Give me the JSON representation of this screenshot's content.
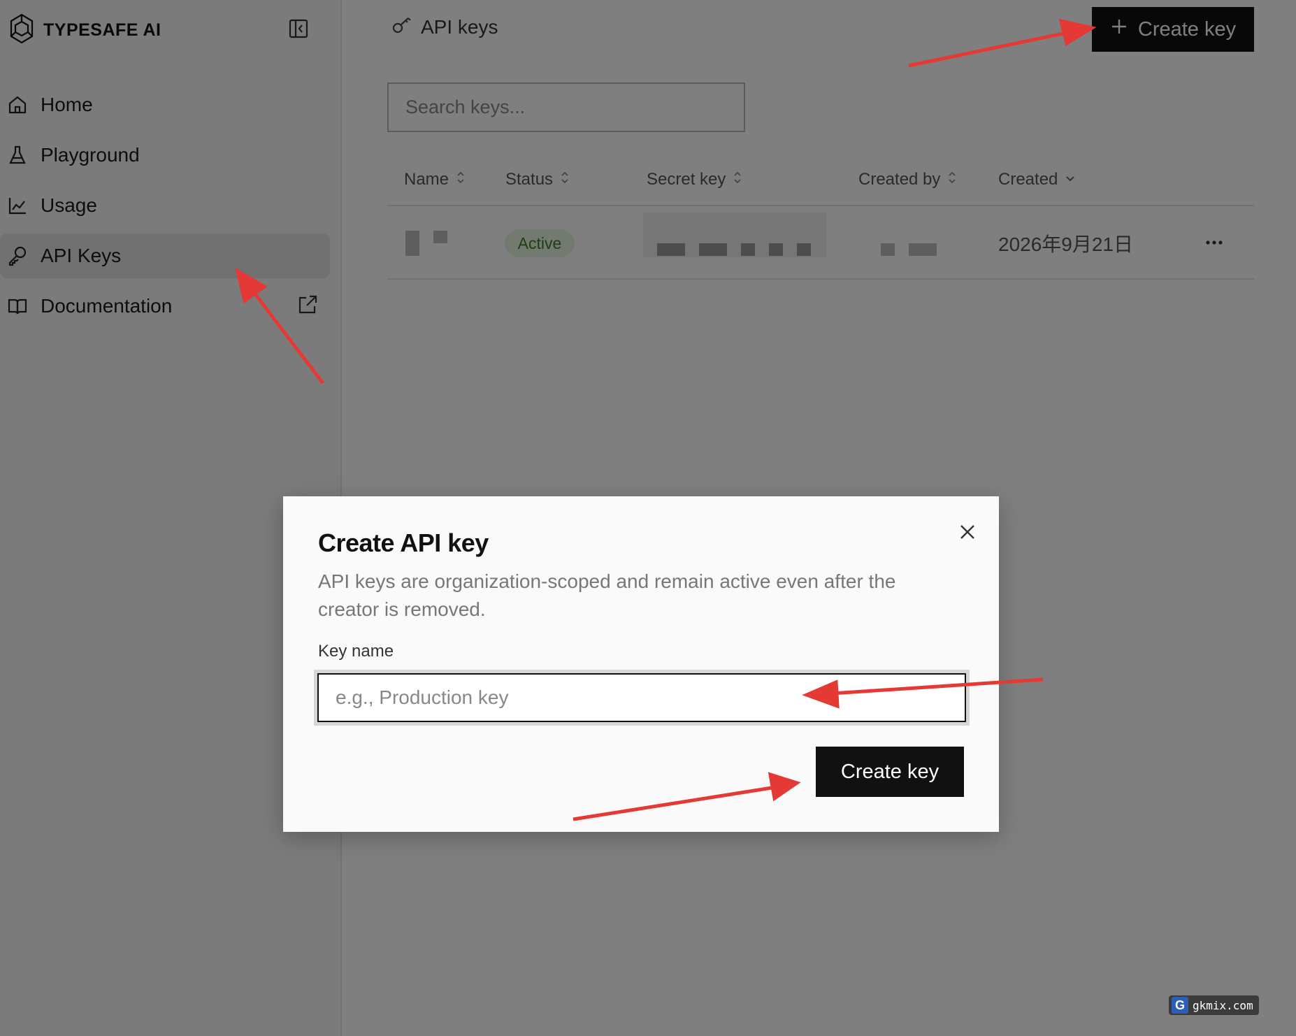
{
  "brand": {
    "name": "TYPESAFE AI"
  },
  "sidebar": {
    "items": [
      {
        "label": "Home",
        "icon": "home-icon"
      },
      {
        "label": "Playground",
        "icon": "flask-icon"
      },
      {
        "label": "Usage",
        "icon": "chart-icon"
      },
      {
        "label": "API Keys",
        "icon": "key-icon",
        "active": true
      },
      {
        "label": "Documentation",
        "icon": "book-icon",
        "external": true
      }
    ]
  },
  "header": {
    "title": "API keys",
    "create_label": "Create key"
  },
  "search": {
    "placeholder": "Search keys..."
  },
  "table": {
    "columns": [
      "Name",
      "Status",
      "Secret key",
      "Created by",
      "Created"
    ],
    "rows": [
      {
        "status": "Active",
        "created": "2026年9月21日"
      }
    ]
  },
  "dialog": {
    "title": "Create API key",
    "description": "API keys are organization-scoped and remain active even after the creator is removed.",
    "field_label": "Key name",
    "field_placeholder": "e.g., Production key",
    "field_value": "",
    "submit_label": "Create key"
  },
  "watermark": {
    "text": "gkmix.com",
    "badge": "G"
  },
  "colors": {
    "primary": "#111111",
    "overlay": "rgba(0,0,0,0.5)",
    "active_badge_bg": "#e7f4e0",
    "active_badge_fg": "#3e7a2e",
    "annotation_arrow": "#e53935"
  }
}
